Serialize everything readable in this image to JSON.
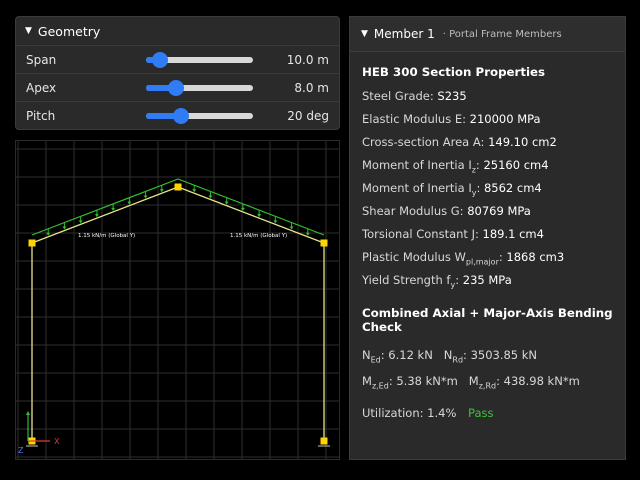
{
  "geometry": {
    "title": "Geometry",
    "rows": [
      {
        "label": "Span",
        "value": "10.0 m",
        "fraction": 0.13
      },
      {
        "label": "Apex",
        "value": "8.0 m",
        "fraction": 0.28
      },
      {
        "label": "Pitch",
        "value": "20 deg",
        "fraction": 0.33
      }
    ]
  },
  "viewport": {
    "load_left": "1.15 kN/m (Global Y)",
    "load_right": "1.15 kN/m (Global Y)",
    "axis_x": "X",
    "axis_z": "Z",
    "frame_color": "#e6e38a",
    "load_color": "#2fbf2f",
    "node_color": "#ffd400"
  },
  "member": {
    "title": "Member 1",
    "subtitle": "Portal Frame Members",
    "section_title": "HEB 300 Section Properties",
    "props": {
      "grade_label": "Steel Grade:",
      "grade_value": "S235",
      "e_label": "Elastic Modulus E:",
      "e_value": "210000 MPa",
      "a_label": "Cross-section Area A:",
      "a_value": "149.10 cm2",
      "iz_label_pre": "Moment of Inertia I",
      "iz_sub": "z",
      "iz_value": "25160 cm4",
      "iy_label_pre": "Moment of Inertia I",
      "iy_sub": "y",
      "iy_value": "8562 cm4",
      "g_label": "Shear Modulus G:",
      "g_value": "80769 MPa",
      "j_label": "Torsional Constant J:",
      "j_value": "189.1 cm4",
      "wpl_label_pre": "Plastic Modulus W",
      "wpl_sub": "pl,major",
      "wpl_value": "1868 cm3",
      "fy_label_pre": "Yield Strength f",
      "fy_sub": "y",
      "fy_value": "235 MPa"
    },
    "check_title": "Combined Axial + Major-Axis Bending Check",
    "check": {
      "ned_pre": "N",
      "ned_sub": "Ed",
      "ned_value": "6.12 kN",
      "nrd_pre": "N",
      "nrd_sub": "Rd",
      "nrd_value": "3503.85 kN",
      "med_pre": "M",
      "med_sub": "z,Ed",
      "med_value": "5.38 kN*m",
      "mrd_pre": "M",
      "mrd_sub": "z,Rd",
      "mrd_value": "438.98 kN*m",
      "util_label": "Utilization:",
      "util_value": "1.4%",
      "status": "Pass"
    }
  }
}
